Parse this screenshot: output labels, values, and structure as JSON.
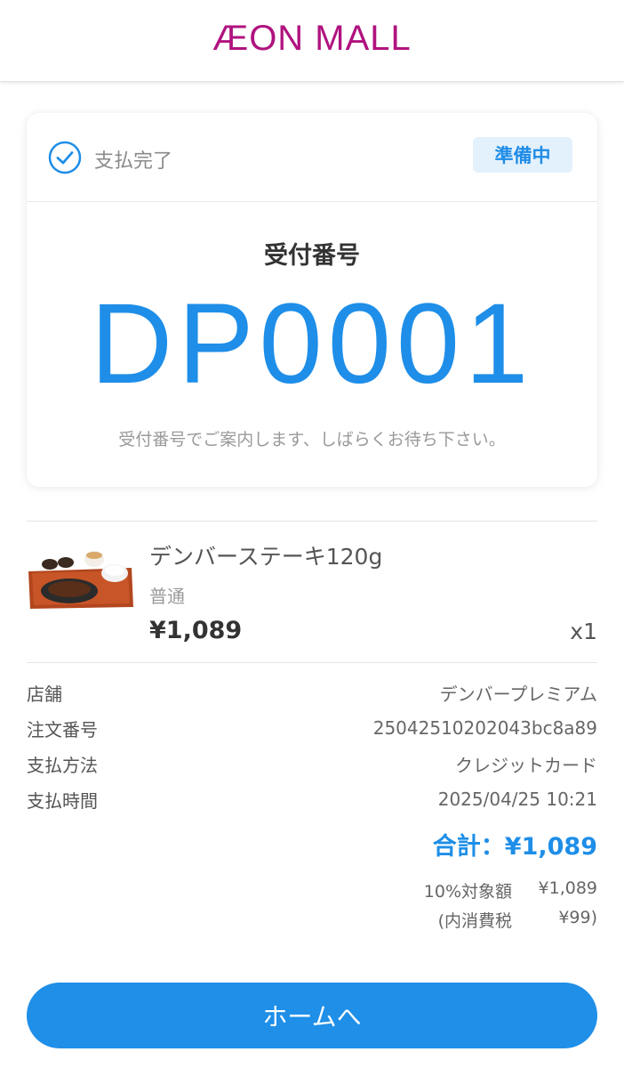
{
  "header": {
    "logo_text": "ÆON MALL",
    "logo_color": "#b0127f"
  },
  "status": {
    "paid_label": "支払完了",
    "badge": "準備中",
    "reception_title": "受付番号",
    "reception_number": "DP0001",
    "note": "受付番号でご案内します、しばらくお待ち下さい。"
  },
  "item": {
    "name": "デンバーステーキ120g",
    "option": "普通",
    "price": "¥1,089",
    "quantity": "x1"
  },
  "order_info": [
    {
      "label": "店舗",
      "value": "デンバープレミアム"
    },
    {
      "label": "注文番号",
      "value": "25042510202043bc8a89"
    },
    {
      "label": "支払方法",
      "value": "クレジットカード"
    },
    {
      "label": "支払時間",
      "value": "2025/04/25 10:21"
    }
  ],
  "total": "合計：¥1,089",
  "tax": {
    "taxable_label": "10%対象額",
    "taxable_value": "¥1,089",
    "consumption_label": "(内消費税",
    "consumption_value": "¥99)"
  },
  "home_button": "ホームへ",
  "colors": {
    "accent": "#1e8ee8",
    "badge_bg": "#e3f1fd"
  }
}
